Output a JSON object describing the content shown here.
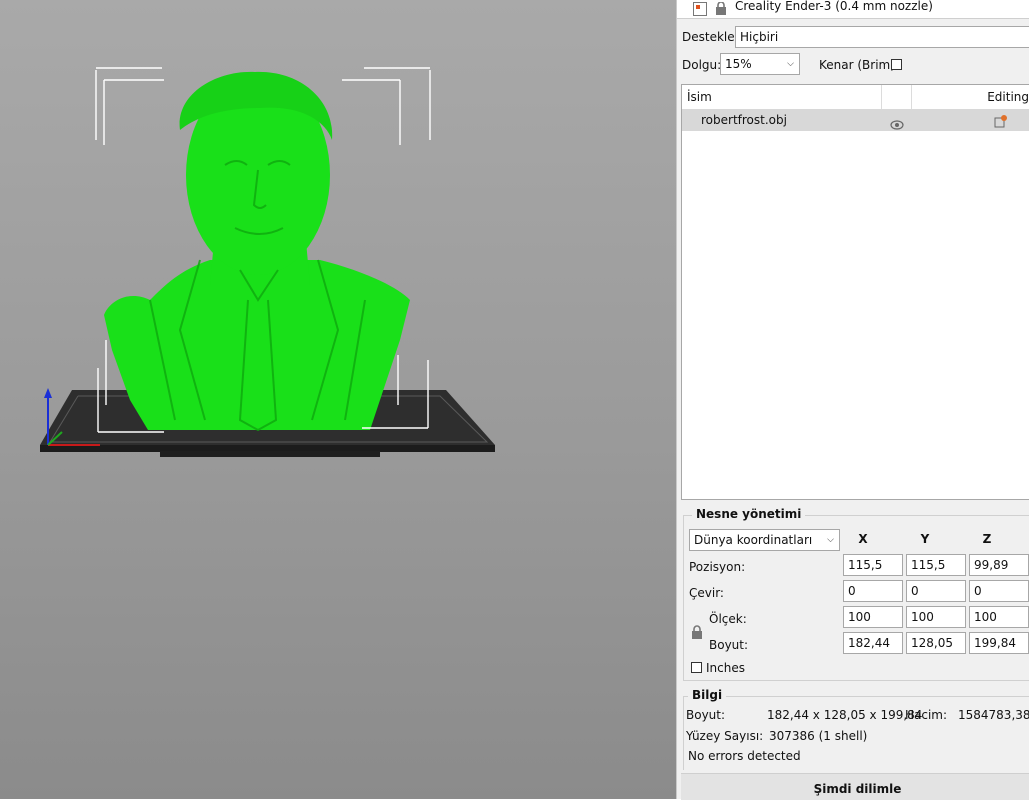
{
  "printer": {
    "name": "Creality Ender-3 (0.4 mm nozzle)"
  },
  "settings": {
    "supports_label": "Destekler:",
    "supports_value": "Hiçbiri",
    "infill_label": "Dolgu:",
    "infill_value": "15%",
    "brim_label": "Kenar (Brim):"
  },
  "object_list": {
    "col_name": "İsim",
    "col_editing": "Editing",
    "items": [
      {
        "name": "robertfrost.obj"
      }
    ]
  },
  "object_manipulation": {
    "title": "Nesne yönetimi",
    "coord_system": "Dünya koordinatları",
    "axes": [
      "X",
      "Y",
      "Z"
    ],
    "position_label": "Pozisyon:",
    "position": [
      "115,5",
      "115,5",
      "99,89"
    ],
    "rotate_label": "Çevir:",
    "rotation": [
      "0",
      "0",
      "0"
    ],
    "scale_label": "Ölçek:",
    "scale": [
      "100",
      "100",
      "100"
    ],
    "size_label": "Boyut:",
    "size": [
      "182,44",
      "128,05",
      "199,84"
    ],
    "inches_label": "Inches"
  },
  "info": {
    "title": "Bilgi",
    "size_label": "Boyut:",
    "size_value": "182,44 x 128,05 x 199,84",
    "volume_label": "Hacim:",
    "volume_value": "1584783,38",
    "facets_label": "Yüzey Sayısı:",
    "facets_value": "307386 (1 shell)",
    "errors": "No errors detected"
  },
  "slice_button": "Şimdi dilimle",
  "colors": {
    "model": "#19e019",
    "bed": "#2f2f2f",
    "viewport": "#a0a0a0"
  }
}
